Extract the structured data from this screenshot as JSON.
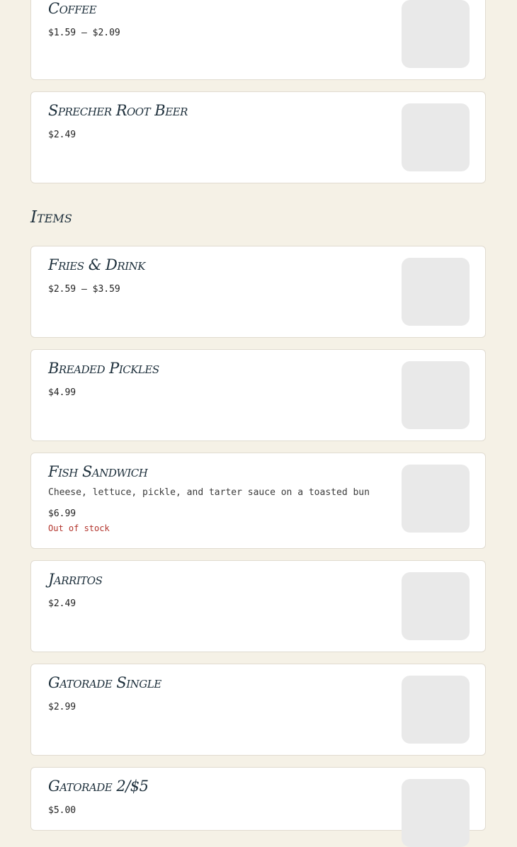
{
  "items_top": [
    {
      "name": "Coffee",
      "price": "$1.59 – $2.09"
    },
    {
      "name": "Sprecher Root Beer",
      "price": "$2.49"
    }
  ],
  "section": {
    "title": "Items"
  },
  "items": [
    {
      "name": "Fries & Drink",
      "price": "$2.59 – $3.59"
    },
    {
      "name": "Breaded Pickles",
      "price": "$4.99"
    },
    {
      "name": "Fish Sandwich",
      "description": "Cheese, lettuce, pickle, and tarter sauce on a toasted bun",
      "price": "$6.99",
      "status": "Out of stock"
    },
    {
      "name": "Jarritos",
      "price": "$2.49"
    },
    {
      "name": "Gatorade Single",
      "price": "$2.99"
    },
    {
      "name": "Gatorade 2/$5",
      "price": "$5.00"
    }
  ],
  "colors": {
    "background": "#f5f1e6",
    "card": "#ffffff",
    "title": "#1d2f3b",
    "out_of_stock": "#b3352d",
    "thumbnail": "#e9e9e9"
  }
}
